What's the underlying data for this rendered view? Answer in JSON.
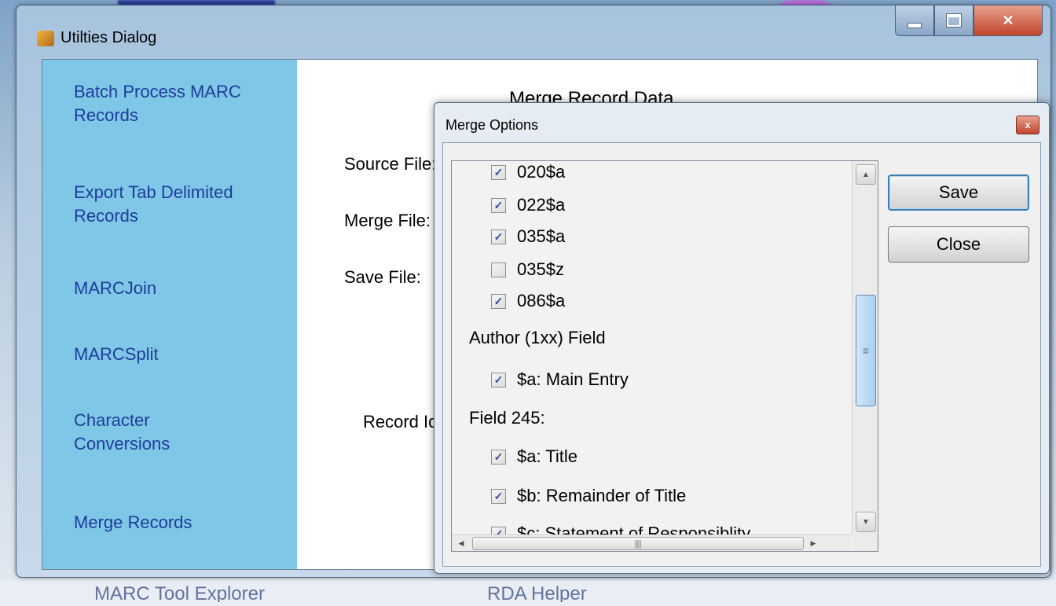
{
  "window": {
    "title": "Utilties Dialog"
  },
  "sidebar": {
    "items": [
      {
        "label": "Batch Process MARC Records"
      },
      {
        "label": "Export Tab Delimited Records"
      },
      {
        "label": "MARCJoin"
      },
      {
        "label": "MARCSplit"
      },
      {
        "label": "Character Conversions"
      },
      {
        "label": "Merge Records"
      }
    ]
  },
  "panel": {
    "heading": "Merge Record Data",
    "source_label": "Source File:",
    "merge_label": "Merge File:",
    "save_label": "Save File:",
    "record_label": "Record Identifier:"
  },
  "modal": {
    "title": "Merge Options",
    "close_glyph": "x",
    "save_label": "Save",
    "close_label": "Close",
    "rows": [
      {
        "type": "check",
        "label": "020$a",
        "checked": true
      },
      {
        "type": "check",
        "label": "022$a",
        "checked": true
      },
      {
        "type": "check",
        "label": "035$a",
        "checked": true
      },
      {
        "type": "check",
        "label": "035$z",
        "checked": false
      },
      {
        "type": "check",
        "label": "086$a",
        "checked": true
      },
      {
        "type": "header",
        "label": "Author (1xx) Field"
      },
      {
        "type": "check",
        "label": "$a: Main Entry",
        "checked": true
      },
      {
        "type": "header",
        "label": "Field 245:"
      },
      {
        "type": "check",
        "label": "$a: Title",
        "checked": true
      },
      {
        "type": "check",
        "label": "$b: Remainder of Title",
        "checked": true
      },
      {
        "type": "check",
        "label": "$c: Statement of Responsiblity",
        "checked": true
      }
    ]
  },
  "background": {
    "bottom_left": "MARC Tool Explorer",
    "bottom_mid": "RDA Helper"
  },
  "colors": {
    "sidebar": "#7ec7e7",
    "nav_text": "#1f3b9a",
    "close_red": "#c2452c"
  }
}
